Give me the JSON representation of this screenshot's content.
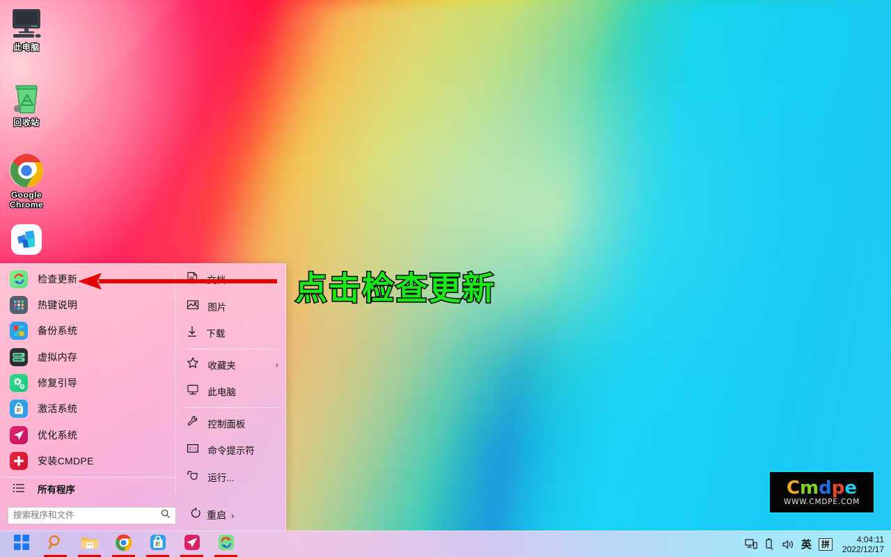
{
  "desktop": {
    "icons": [
      {
        "name": "this-pc",
        "label": "此电脑",
        "icon": "monitor-icon"
      },
      {
        "name": "recycle-bin",
        "label": "回收站",
        "icon": "recycle-bin-icon"
      },
      {
        "name": "google-chrome",
        "label": "Google\nChrome",
        "icon": "chrome-icon"
      },
      {
        "name": "teams-app",
        "label": "",
        "icon": "blue-app-icon"
      }
    ]
  },
  "annotation": {
    "text": "点击检查更新",
    "text_color": "#18e818",
    "outline_color": "#000000",
    "arrow_color": "#e60000"
  },
  "start_menu": {
    "left_items": [
      {
        "label": "检查更新",
        "icon": "update-icon"
      },
      {
        "label": "热键说明",
        "icon": "hotkey-icon"
      },
      {
        "label": "备份系统",
        "icon": "backup-icon"
      },
      {
        "label": "虚拟内存",
        "icon": "memory-icon"
      },
      {
        "label": "修复引导",
        "icon": "repair-boot-icon"
      },
      {
        "label": "激活系统",
        "icon": "activate-icon"
      },
      {
        "label": "优化系统",
        "icon": "optimize-icon"
      },
      {
        "label": "安装CMDPE",
        "icon": "install-icon"
      }
    ],
    "all_programs": {
      "label": "所有程序",
      "icon": "list-icon"
    },
    "right_items": [
      {
        "label": "文档",
        "icon": "document-icon",
        "chevron": "",
        "sep_after": false
      },
      {
        "label": "图片",
        "icon": "picture-icon",
        "chevron": "",
        "sep_after": false
      },
      {
        "label": "下载",
        "icon": "download-icon",
        "chevron": "",
        "sep_after": true
      },
      {
        "label": "收藏夹",
        "icon": "star-icon",
        "chevron": "›",
        "sep_after": false
      },
      {
        "label": "此电脑",
        "icon": "computer-icon",
        "chevron": "",
        "sep_after": true
      },
      {
        "label": "控制面板",
        "icon": "control-panel-icon",
        "chevron": "",
        "sep_after": false
      },
      {
        "label": "命令提示符",
        "icon": "command-prompt-icon",
        "chevron": "",
        "sep_after": false
      },
      {
        "label": "运行...",
        "icon": "run-icon",
        "chevron": "",
        "sep_after": false
      }
    ],
    "search": {
      "placeholder": "搜索程序和文件",
      "value": "",
      "icon": "search-icon"
    },
    "restart": {
      "label": "重启",
      "icon": "power-restart-icon",
      "chevron": "›"
    }
  },
  "watermark": {
    "letters": [
      {
        "char": "C",
        "color": "#f5a623"
      },
      {
        "char": "m",
        "color": "#7ed321"
      },
      {
        "char": "d",
        "color": "#1f6fe0"
      },
      {
        "char": "p",
        "color": "#e8462c"
      },
      {
        "char": "e",
        "color": "#1fc8e8"
      }
    ],
    "url": "WWW.CMDPE.COM",
    "border_color": "#18d6f5"
  },
  "taskbar": {
    "buttons": [
      {
        "name": "start-button",
        "icon": "windows-logo-icon",
        "underline": false
      },
      {
        "name": "search-button",
        "icon": "search-icon",
        "underline": true
      },
      {
        "name": "file-explorer",
        "icon": "folder-icon",
        "underline": true
      },
      {
        "name": "chrome-taskbar",
        "icon": "chrome-icon",
        "underline": true
      },
      {
        "name": "store-taskbar",
        "icon": "store-icon",
        "underline": true
      },
      {
        "name": "telegram-taskbar",
        "icon": "telegram-icon",
        "underline": true
      },
      {
        "name": "update-taskbar",
        "icon": "update-icon",
        "underline": true
      }
    ],
    "tray": {
      "network_icon": "network-monitor-icon",
      "usb_icon": "usb-eject-icon",
      "volume_icon": "volume-icon",
      "ime_lang": "英",
      "ime_mode": "拼"
    },
    "clock": {
      "time": "4:04:11",
      "date": "2022/12/17"
    }
  }
}
